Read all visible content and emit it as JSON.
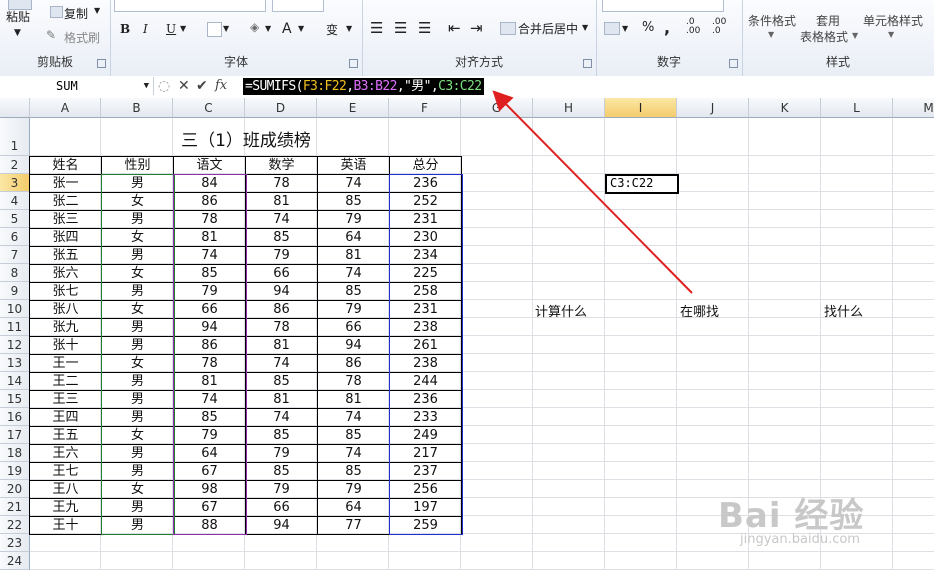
{
  "ribbon": {
    "clipboard": {
      "paste": "粘贴",
      "copy": "复制",
      "format_painter": "格式刷",
      "label": "剪贴板"
    },
    "font": {
      "label": "字体",
      "bold": "B",
      "italic": "I",
      "underline": "U",
      "font_color": "A",
      "phonetic": "变"
    },
    "alignment": {
      "merge": "合并后居中",
      "label": "对齐方式"
    },
    "number": {
      "label": "数字",
      "percent": "%",
      "comma": ","
    },
    "styles": {
      "conditional": "条件格式",
      "table_line1": "套用",
      "table_line2": "表格格式",
      "cell_styles": "单元格样式",
      "label": "样式"
    }
  },
  "formula_bar": {
    "name_box": "SUM",
    "fx": "fx",
    "formula_parts": [
      {
        "text": "=SUMIFS(",
        "color": "#ffffff"
      },
      {
        "text": "F3:F22",
        "color": "#f0c020"
      },
      {
        "text": ",",
        "color": "#ffffff"
      },
      {
        "text": "B3:B22",
        "color": "#e070ff"
      },
      {
        "text": ",\"男\",",
        "color": "#ffffff"
      },
      {
        "text": "C3:C22",
        "color": "#7fe07f"
      }
    ]
  },
  "columns": [
    "A",
    "B",
    "C",
    "D",
    "E",
    "F",
    "G",
    "H",
    "I",
    "J",
    "K",
    "L",
    "M"
  ],
  "rows": [
    "1",
    "2",
    "3",
    "4",
    "5",
    "6",
    "7",
    "8",
    "9",
    "10",
    "11",
    "12",
    "13",
    "14",
    "15",
    "16",
    "17",
    "18",
    "19",
    "20",
    "21",
    "22",
    "23",
    "24"
  ],
  "sheet": {
    "title": "三（1）班成绩榜",
    "headers": [
      "姓名",
      "性别",
      "语文",
      "数学",
      "英语",
      "总分"
    ],
    "records": [
      [
        "张一",
        "男",
        "84",
        "78",
        "74",
        "236"
      ],
      [
        "张二",
        "女",
        "86",
        "81",
        "85",
        "252"
      ],
      [
        "张三",
        "男",
        "78",
        "74",
        "79",
        "231"
      ],
      [
        "张四",
        "女",
        "81",
        "85",
        "64",
        "230"
      ],
      [
        "张五",
        "男",
        "74",
        "79",
        "81",
        "234"
      ],
      [
        "张六",
        "女",
        "85",
        "66",
        "74",
        "225"
      ],
      [
        "张七",
        "男",
        "79",
        "94",
        "85",
        "258"
      ],
      [
        "张八",
        "女",
        "66",
        "86",
        "79",
        "231"
      ],
      [
        "张九",
        "男",
        "94",
        "78",
        "66",
        "238"
      ],
      [
        "张十",
        "男",
        "86",
        "81",
        "94",
        "261"
      ],
      [
        "王一",
        "女",
        "78",
        "74",
        "86",
        "238"
      ],
      [
        "王二",
        "男",
        "81",
        "85",
        "78",
        "244"
      ],
      [
        "王三",
        "男",
        "74",
        "81",
        "81",
        "236"
      ],
      [
        "王四",
        "男",
        "85",
        "74",
        "74",
        "233"
      ],
      [
        "王五",
        "女",
        "79",
        "85",
        "85",
        "249"
      ],
      [
        "王六",
        "男",
        "64",
        "79",
        "74",
        "217"
      ],
      [
        "王七",
        "男",
        "67",
        "85",
        "85",
        "237"
      ],
      [
        "王八",
        "女",
        "98",
        "79",
        "79",
        "256"
      ],
      [
        "王九",
        "男",
        "67",
        "66",
        "64",
        "197"
      ],
      [
        "王十",
        "男",
        "88",
        "94",
        "77",
        "259"
      ]
    ],
    "active_cell_text": "C3:C22",
    "note_what": "计算什么",
    "note_where": "在哪找",
    "note_find": "找什么"
  },
  "colors": {
    "arrow": "#e02020",
    "sum_range": "#2030d0",
    "criteria_range": "#208030",
    "sum_col_range": "#9030b0",
    "select_header": "#f3cc6b"
  },
  "watermark": {
    "brand": "Bai 经验",
    "url": "jingyan.baidu.com"
  }
}
